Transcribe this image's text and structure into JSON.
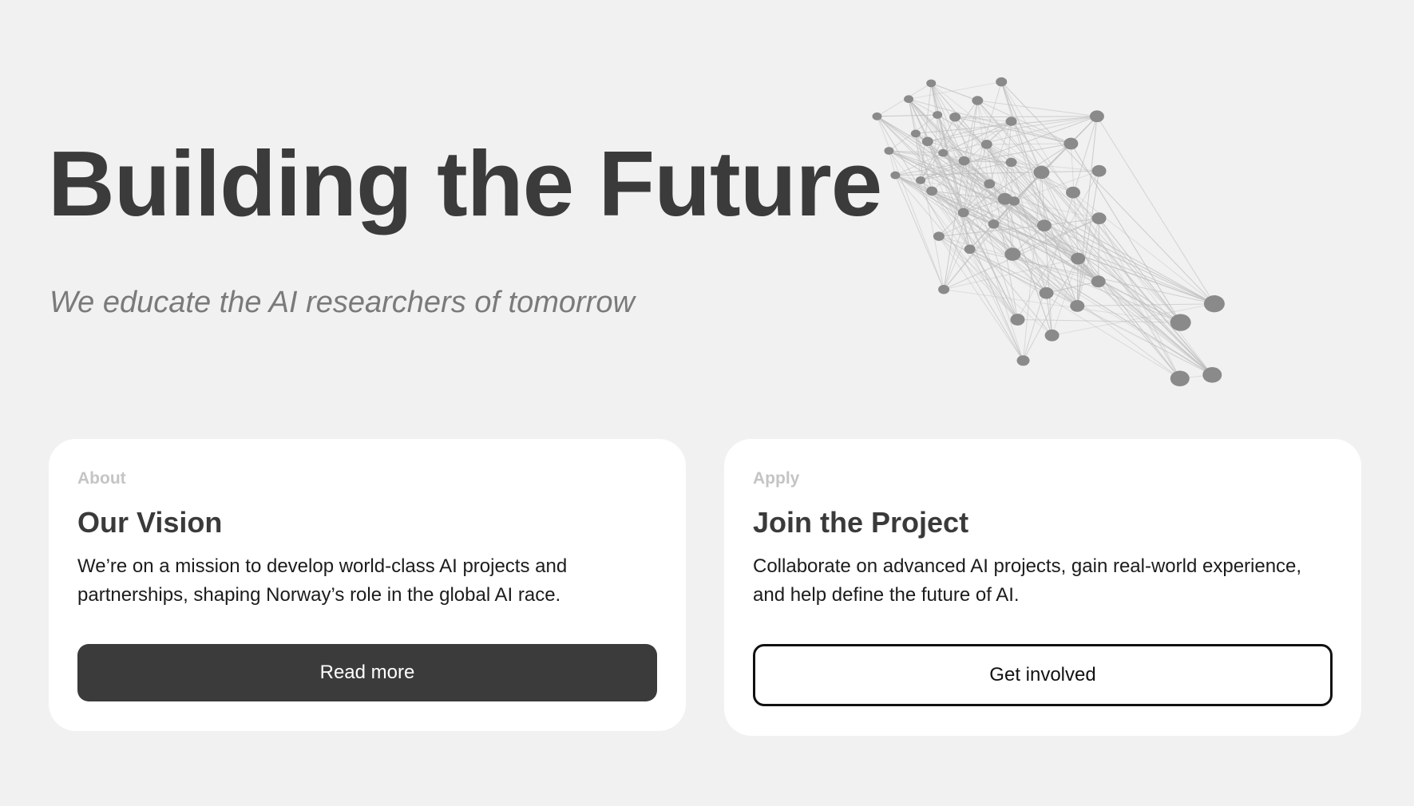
{
  "hero": {
    "title": "Building the Future",
    "subtitle": "We educate the AI researchers of tomorrow"
  },
  "decor": {
    "icon": "network-graph-icon",
    "node_color": "#8a8a8a",
    "edge_color": "#bdbdbd"
  },
  "cards": [
    {
      "eyebrow": "About",
      "title": "Our Vision",
      "body": "We’re on a mission to develop world-class AI projects and partnerships, shaping Norway’s role in the global AI race.",
      "button_label": "Read more"
    },
    {
      "eyebrow": "Apply",
      "title": "Join the Project",
      "body": "Collaborate on advanced AI projects, gain real-world experience, and help define the future of AI.",
      "button_label": "Get involved"
    }
  ],
  "colors": {
    "background": "#f1f1f1",
    "dark_button": "#3b3b3b",
    "card": "#ffffff",
    "eyebrow": "#c4c4c4"
  }
}
